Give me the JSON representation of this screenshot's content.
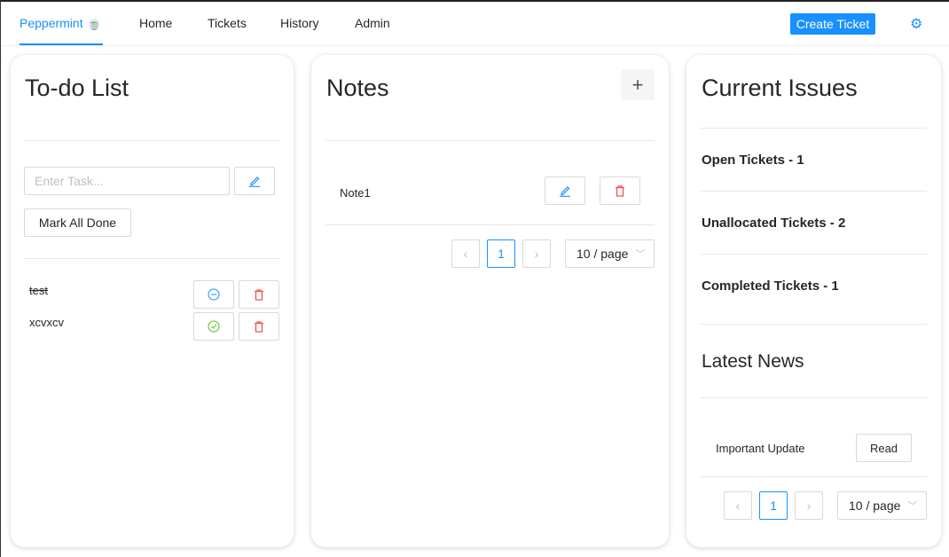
{
  "nav": {
    "brand": "Peppermint",
    "brand_emoji": "🍵",
    "items": [
      "Home",
      "Tickets",
      "History",
      "Admin"
    ],
    "create_ticket": "Create Ticket"
  },
  "todo": {
    "title": "To-do List",
    "placeholder": "Enter Task...",
    "mark_all": "Mark All Done",
    "tasks": [
      {
        "text": "test",
        "done": true
      },
      {
        "text": "xcvxcv",
        "done": false
      }
    ]
  },
  "notes": {
    "title": "Notes",
    "items": [
      "Note1"
    ],
    "page": "1",
    "page_size": "10 / page"
  },
  "issues": {
    "title": "Current Issues",
    "open": "Open Tickets - 1",
    "unallocated": "Unallocated Tickets - 2",
    "completed": "Completed Tickets - 1"
  },
  "news": {
    "title": "Latest News",
    "items": [
      {
        "title": "Important Update",
        "action": "Read"
      }
    ],
    "page": "1",
    "page_size": "10 / page"
  },
  "colors": {
    "primary": "#1890ff",
    "danger": "#ff4d4f",
    "success": "#52c41a"
  }
}
